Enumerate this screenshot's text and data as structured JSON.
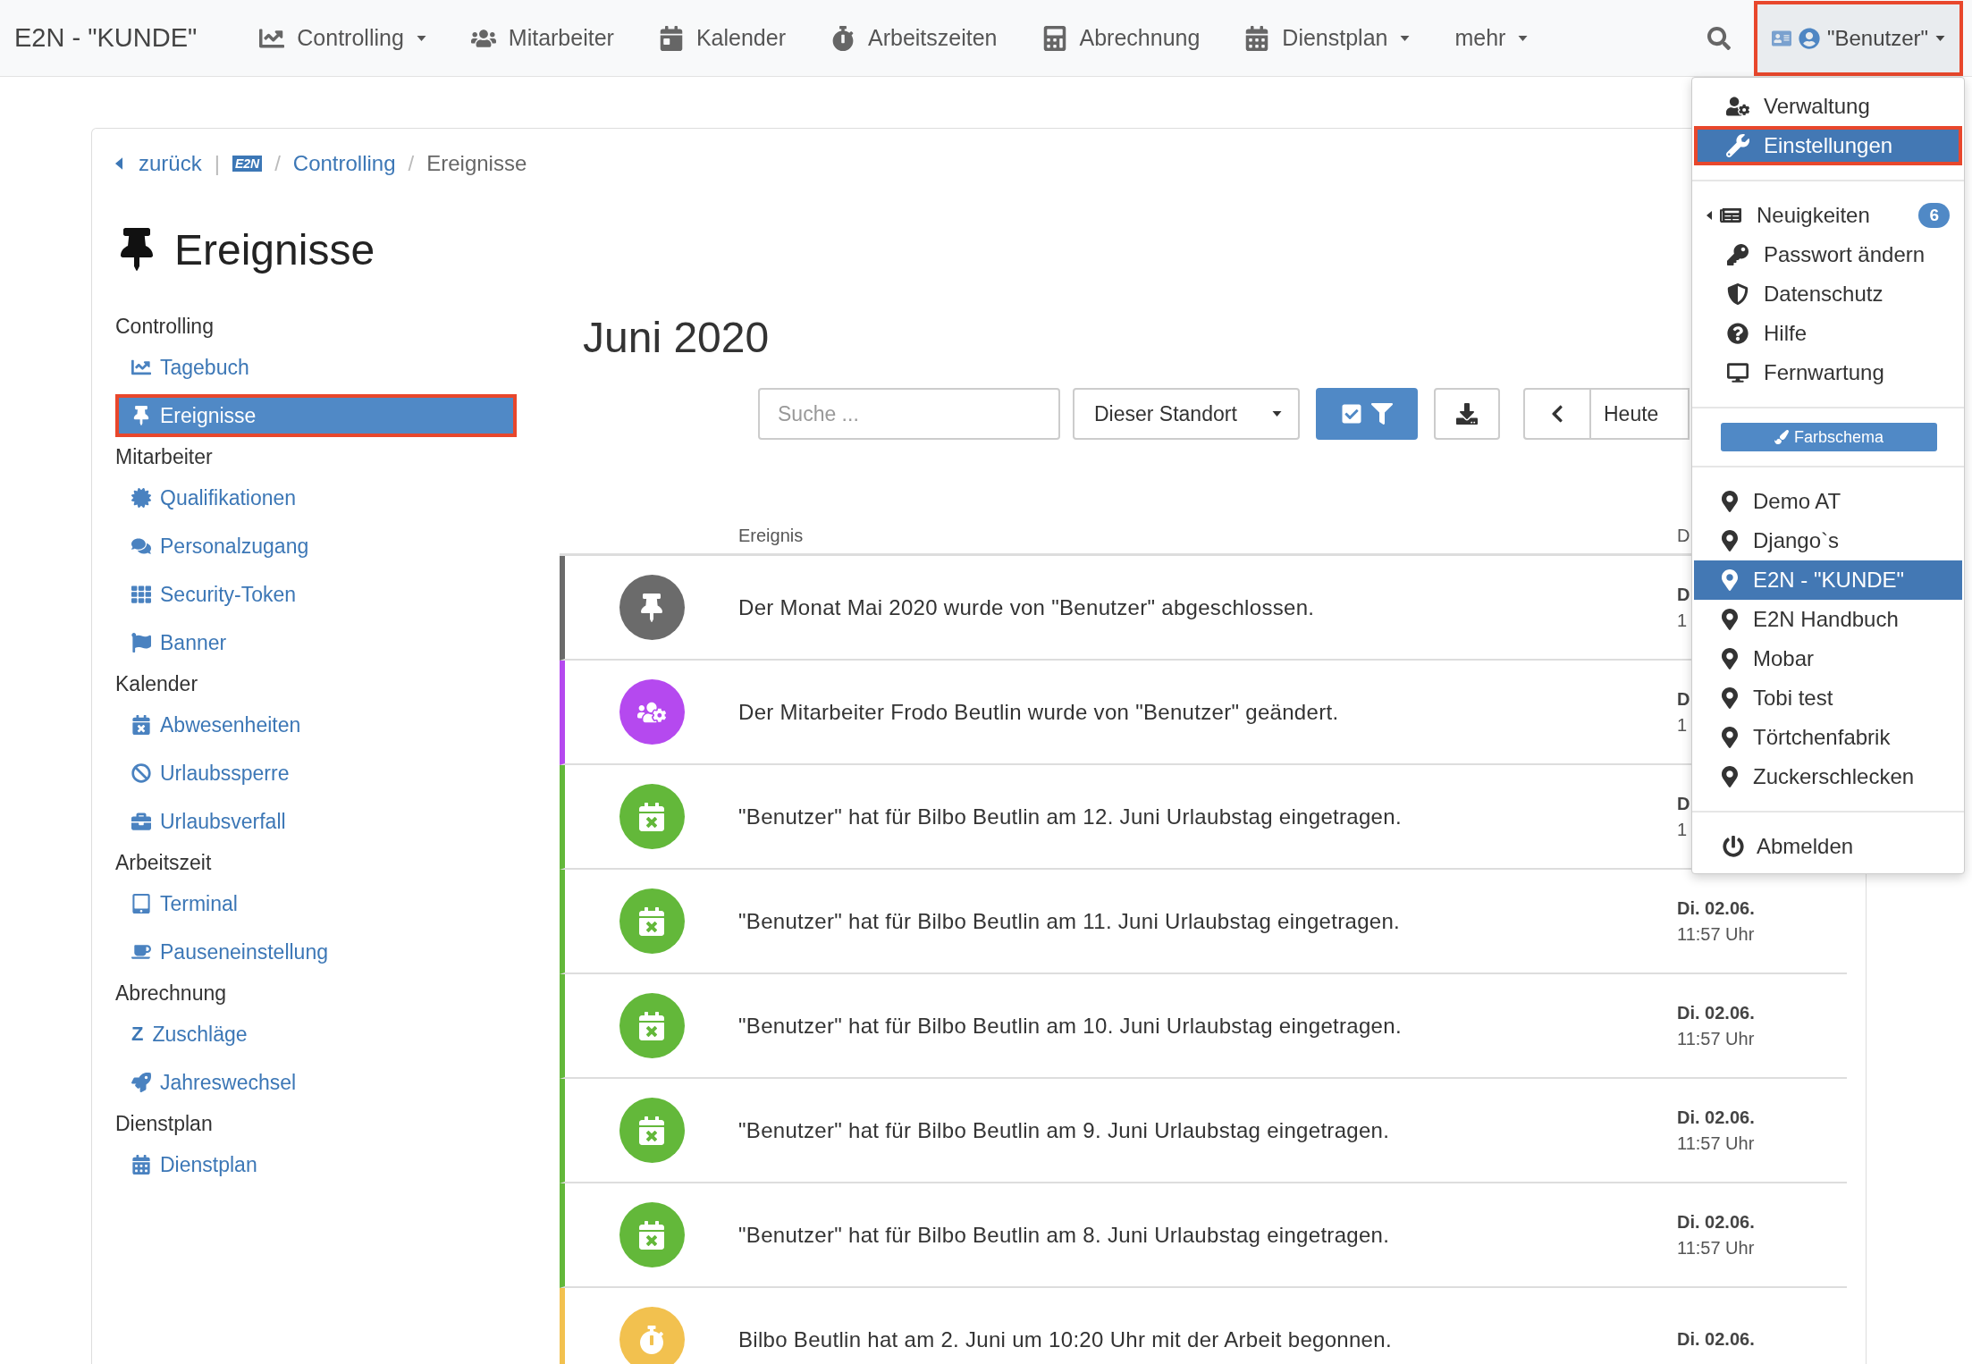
{
  "navbar": {
    "brand": "E2N - \"KUNDE\"",
    "items": [
      {
        "label": "Controlling",
        "dropdown": true
      },
      {
        "label": "Mitarbeiter",
        "dropdown": false
      },
      {
        "label": "Kalender",
        "dropdown": false
      },
      {
        "label": "Arbeitszeiten",
        "dropdown": false
      },
      {
        "label": "Abrechnung",
        "dropdown": false
      },
      {
        "label": "Dienstplan",
        "dropdown": true
      },
      {
        "label": "mehr",
        "dropdown": true
      }
    ],
    "user": {
      "label": "\"Benutzer\"",
      "highlighted": true
    }
  },
  "breadcrumb": {
    "back": "zurück",
    "divider": "|",
    "logo": "E2N",
    "items": [
      {
        "sep": "/",
        "label": "Controlling",
        "current": false
      },
      {
        "sep": "/",
        "label": "Ereignisse",
        "current": true
      }
    ]
  },
  "page_title": "Ereignisse",
  "sidebar": {
    "groups": [
      {
        "title": "Controlling",
        "items": [
          {
            "label": "Tagebuch",
            "selected": false,
            "highlighted": false
          },
          {
            "label": "Ereignisse",
            "selected": true,
            "highlighted": true
          }
        ]
      },
      {
        "title": "Mitarbeiter",
        "items": [
          {
            "label": "Qualifikationen",
            "selected": false,
            "highlighted": false
          },
          {
            "label": "Personalzugang",
            "selected": false,
            "highlighted": false
          },
          {
            "label": "Security-Token",
            "selected": false,
            "highlighted": false
          },
          {
            "label": "Banner",
            "selected": false,
            "highlighted": false
          }
        ]
      },
      {
        "title": "Kalender",
        "items": [
          {
            "label": "Abwesenheiten",
            "selected": false,
            "highlighted": false
          },
          {
            "label": "Urlaubssperre",
            "selected": false,
            "highlighted": false
          },
          {
            "label": "Urlaubsverfall",
            "selected": false,
            "highlighted": false
          }
        ]
      },
      {
        "title": "Arbeitszeit",
        "items": [
          {
            "label": "Terminal",
            "selected": false,
            "highlighted": false
          },
          {
            "label": "Pauseneinstellung",
            "selected": false,
            "highlighted": false
          }
        ]
      },
      {
        "title": "Abrechnung",
        "items": [
          {
            "label": "Zuschläge",
            "mark": "Z",
            "selected": false,
            "highlighted": false
          },
          {
            "label": "Jahreswechsel",
            "selected": false,
            "highlighted": false
          }
        ]
      },
      {
        "title": "Dienstplan",
        "items": [
          {
            "label": "Dienstplan",
            "selected": false,
            "highlighted": false
          }
        ]
      }
    ]
  },
  "month": "Juni 2020",
  "toolbar": {
    "search": {
      "placeholder": "Suche ..."
    },
    "location_select": "Dieser Standort",
    "today": "Heute"
  },
  "table": {
    "columns": [
      "Ereignis",
      "D"
    ],
    "rows": [
      {
        "kind": "closed",
        "color": "#6b6b6b",
        "text": "Der Monat Mai 2020 wurde von \"Benutzer\" abgeschlossen.",
        "date": "D",
        "time": "1"
      },
      {
        "kind": "employee",
        "color": "#b549ef",
        "text": "Der Mitarbeiter Frodo Beutlin wurde von \"Benutzer\" geändert.",
        "date": "D",
        "time": "1"
      },
      {
        "kind": "absence",
        "color": "#63b83a",
        "text": "\"Benutzer\" hat für Bilbo Beutlin am 12. Juni Urlaubstag eingetragen.",
        "date": "D",
        "time": "1"
      },
      {
        "kind": "absence",
        "color": "#63b83a",
        "text": "\"Benutzer\" hat für Bilbo Beutlin am 11. Juni Urlaubstag eingetragen.",
        "date": "Di. 02.06.",
        "time": "11:57 Uhr"
      },
      {
        "kind": "absence",
        "color": "#63b83a",
        "text": "\"Benutzer\" hat für Bilbo Beutlin am 10. Juni Urlaubstag eingetragen.",
        "date": "Di. 02.06.",
        "time": "11:57 Uhr"
      },
      {
        "kind": "absence",
        "color": "#63b83a",
        "text": "\"Benutzer\" hat für Bilbo Beutlin am 9. Juni Urlaubstag eingetragen.",
        "date": "Di. 02.06.",
        "time": "11:57 Uhr"
      },
      {
        "kind": "absence",
        "color": "#63b83a",
        "text": "\"Benutzer\" hat für Bilbo Beutlin am 8. Juni Urlaubstag eingetragen.",
        "date": "Di. 02.06.",
        "time": "11:57 Uhr"
      },
      {
        "kind": "work",
        "color": "#f2c14f",
        "text": "Bilbo Beutlin hat am 2. Juni um 10:20 Uhr mit der Arbeit begonnen.",
        "date": "Di. 02.06."
      }
    ]
  },
  "user_menu": {
    "admin": [
      {
        "label": "Verwaltung",
        "selected": false,
        "highlighted": false
      },
      {
        "label": "Einstellungen",
        "selected": true,
        "highlighted": true
      }
    ],
    "account": [
      {
        "label": "Neuigkeiten",
        "count": "6",
        "submenu": true
      },
      {
        "label": "Passwort ändern",
        "submenu": false
      },
      {
        "label": "Datenschutz",
        "submenu": false
      },
      {
        "label": "Hilfe",
        "submenu": false
      },
      {
        "label": "Fernwartung",
        "submenu": false
      }
    ],
    "theme_button": "Farbschema",
    "locations": [
      {
        "label": "Demo AT",
        "selected": false
      },
      {
        "label": "Django`s",
        "selected": false
      },
      {
        "label": "E2N - \"KUNDE\"",
        "selected": true
      },
      {
        "label": "E2N Handbuch",
        "selected": false
      },
      {
        "label": "Mobar",
        "selected": false
      },
      {
        "label": "Tobi test",
        "selected": false
      },
      {
        "label": "Törtchenfabrik",
        "selected": false
      },
      {
        "label": "Zuckerschlecken",
        "selected": false
      }
    ],
    "logout": "Abmelden"
  }
}
